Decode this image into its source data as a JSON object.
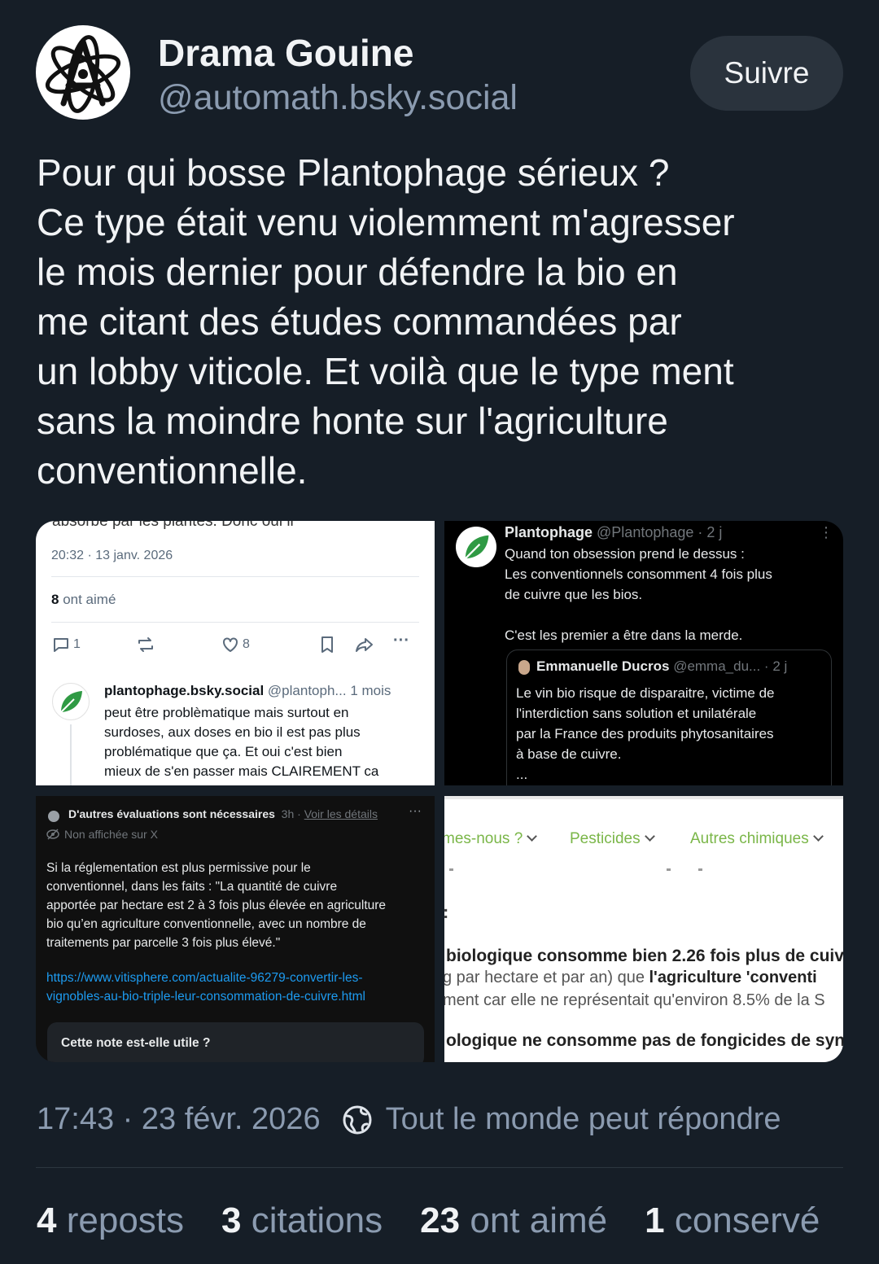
{
  "author": {
    "name": "Drama Gouine",
    "handle": "@automath.bsky.social",
    "follow_label": "Suivre"
  },
  "post": {
    "lines": [
      "Pour qui bosse Plantophage sérieux ?",
      "Ce type était venu violemment m'agresser",
      "le mois dernier pour défendre la bio en",
      "me citant des études commandées par",
      "un lobby viticole. Et voilà que le type ment",
      "sans la moindre honte sur l'agriculture",
      "conventionnelle."
    ]
  },
  "media": {
    "tile1": {
      "cut_text": "absorbé par les plantes. Donc oui il",
      "timestamp": "20:32 · 13 janv. 2026",
      "likes_count": "8",
      "likes_label": "ont aimé",
      "reply_count": "1",
      "like_count": "8",
      "reply_name": "plantophage.bsky.social",
      "reply_handle": "@plantoph...",
      "reply_time": "1 mois",
      "reply_lines": [
        "peut être problèmatique mais surtout en",
        "surdoses, aux doses en bio il est pas plus",
        "problématique que ça. Et oui c'est bien",
        "mieux de s'en passer mais CLAIREMENT ca"
      ]
    },
    "tile2": {
      "name": "Plantophage",
      "handle": "@Plantophage · 2 j",
      "lines": [
        "Quand ton obsession prend le dessus :",
        "Les conventionnels consomment 4 fois plus",
        "de cuivre que les bios.",
        "",
        "C'est les premier a être dans la merde."
      ],
      "quote_name": "Emmanuelle Ducros",
      "quote_handle": "@emma_du... · 2 j",
      "quote_lines": [
        "Le vin bio risque de disparaitre, victime de",
        "l'interdiction sans solution et unilatérale",
        "par la France des produits phytosanitaires",
        "à base de cuivre.",
        "..."
      ]
    },
    "tile3": {
      "note_title": "D'autres évaluations sont nécessaires",
      "note_time": "3h",
      "note_link": "Voir les détails",
      "note_sub": "Non affichée sur X",
      "body_lines": [
        "Si la réglementation est plus permissive pour le",
        "conventionnel, dans les faits : \"La quantité de cuivre",
        "apportée par hectare est 2 à 3 fois plus élevée en agriculture",
        "bio qu’en agriculture conventionnelle, avec un nombre de",
        "traitements par parcelle 3 fois plus élevé.\""
      ],
      "link_lines": [
        "https://www.vitisphere.com/actualite-96279-convertir-les-",
        "vignobles-au-bio-triple-leur-consommation-de-cuivre.html"
      ],
      "helpful_label": "Cette note est-elle utile ?"
    },
    "tile4": {
      "nav": [
        "mes-nous ?",
        "Pesticides",
        "Autres chimiques"
      ],
      "colon": ":",
      "line1_bold": "biologique consomme bien 2.26 fois plus de cuiv",
      "line2_pre": "g par hectare et par an) que ",
      "line2_bold": "l'agriculture 'conventi",
      "line3": "ment car elle ne représentait qu'environ 8.5% de la S",
      "line4": "ologique ne consomme pas de fongicides de syn"
    }
  },
  "meta": {
    "time": "17:43 · 23 févr. 2026",
    "reply_setting": "Tout le monde peut répondre"
  },
  "stats": {
    "reposts_count": "4",
    "reposts_label": "reposts",
    "quotes_count": "3",
    "quotes_label": "citations",
    "likes_count": "23",
    "likes_label": "ont aimé",
    "saves_count": "1",
    "saves_label": "conservé"
  },
  "colors": {
    "background": "#161e27",
    "muted": "#8b9bb0",
    "leaf_green": "#2f9a44",
    "link_blue": "#1d9bf0"
  }
}
